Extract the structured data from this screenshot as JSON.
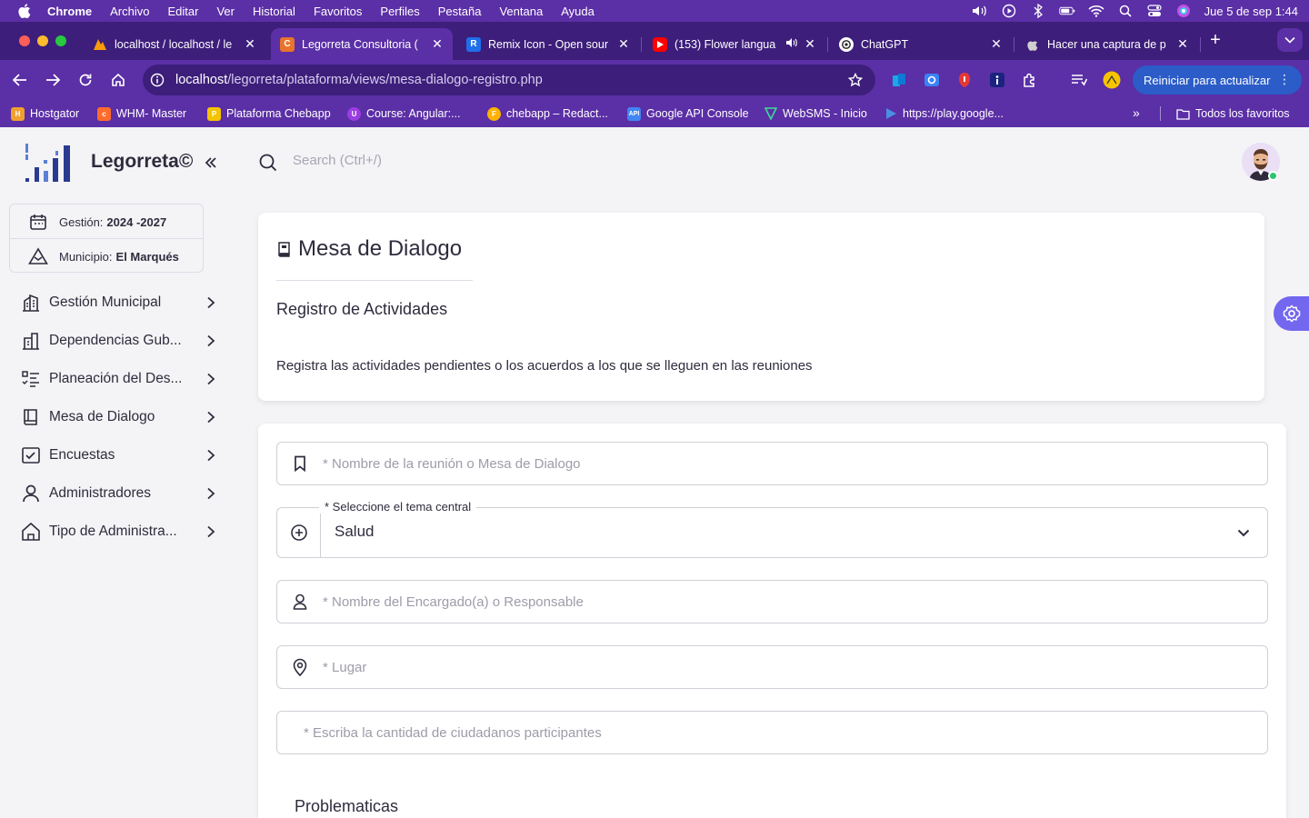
{
  "menubar": {
    "app": "Chrome",
    "items": [
      "Archivo",
      "Editar",
      "Ver",
      "Historial",
      "Favoritos",
      "Perfiles",
      "Pestaña",
      "Ventana",
      "Ayuda"
    ],
    "clock": "Jue 5 de sep  1:44"
  },
  "tabs": [
    {
      "title": "localhost / localhost / le",
      "icon": "phpmyadmin-icon",
      "color": "#f89c0e"
    },
    {
      "title": "Legorreta Consultoria (",
      "icon": "codepen-icon",
      "color": "#e8742b"
    },
    {
      "title": "Remix Icon - Open sour",
      "icon": "remix-icon",
      "color": "#1f6feb"
    },
    {
      "title": "(153) Flower langua",
      "icon": "youtube-icon",
      "color": "#ff0000"
    },
    {
      "title": "ChatGPT",
      "icon": "chatgpt-icon",
      "color": "#ffffff"
    },
    {
      "title": "Hacer una captura de p",
      "icon": "apple-icon",
      "color": "#d0d0d0"
    }
  ],
  "toolbar": {
    "url_host": "localhost",
    "url_path": "/legorreta/plataforma/views/mesa-dialogo-registro.php",
    "update_label": "Reiniciar para actualizar"
  },
  "bookmarks": {
    "items": [
      {
        "label": "Hostgator",
        "color": "#f0a030"
      },
      {
        "label": "WHM-  Master",
        "color": "#ff6c2c"
      },
      {
        "label": "Plataforma Chebapp",
        "color": "#f5c400"
      },
      {
        "label": "Course: Angular:...",
        "color": "#9b3de0"
      },
      {
        "label": "chebapp – Redact...",
        "color": "#ffb300"
      },
      {
        "label": "Google API Console",
        "color": "#4285f4"
      },
      {
        "label": "WebSMS - Inicio",
        "color": "#3ddc97"
      },
      {
        "label": "https://play.google...",
        "color": "#4a90e2"
      }
    ],
    "all_label": "Todos los favoritos"
  },
  "sidebar": {
    "brand": "Legorreta©",
    "gestion_label": "Gestión:",
    "gestion_value": "2024 -2027",
    "municipio_label": "Municipio:",
    "municipio_value": "El Marqués",
    "nav": [
      {
        "label": "Gestión Municipal",
        "icon": "building-icon"
      },
      {
        "label": "Dependencias Gub...",
        "icon": "government-icon"
      },
      {
        "label": "Planeación del Des...",
        "icon": "checklist-icon"
      },
      {
        "label": "Mesa de Dialogo",
        "icon": "book-icon"
      },
      {
        "label": "Encuestas",
        "icon": "survey-icon"
      },
      {
        "label": "Administradores",
        "icon": "user-icon"
      },
      {
        "label": "Tipo de Administra...",
        "icon": "home-icon"
      }
    ]
  },
  "topbar": {
    "search_placeholder": "Search (Ctrl+/)"
  },
  "header": {
    "title": "Mesa de Dialogo",
    "subtitle": "Registro de Actividades",
    "description": "Registra las actividades pendientes o los acuerdos a los que se lleguen en las reuniones"
  },
  "form": {
    "meeting_name_placeholder": "* Nombre de la reunión o Mesa de Dialogo",
    "theme_label": "* Seleccione el tema central",
    "theme_value": "Salud",
    "manager_placeholder": "* Nombre del Encargado(a) o Responsable",
    "place_placeholder": "* Lugar",
    "citizens_placeholder": "* Escriba la cantidad de ciudadanos participantes",
    "problems_title": "Problematicas"
  },
  "colors": {
    "accent": "#7367f0",
    "chrome_frame": "#5b2fa6",
    "update_button": "#2c5cc7",
    "online": "#28c76f"
  }
}
